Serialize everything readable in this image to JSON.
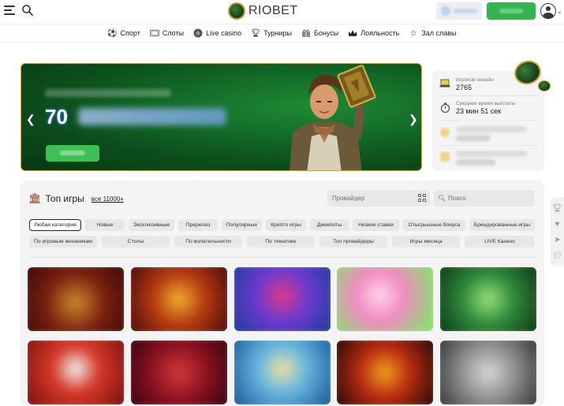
{
  "header": {
    "logo_text": "RIOBET",
    "menu_icon": "hamburger-icon",
    "search_icon": "search-icon",
    "profile_icon": "user-avatar-icon"
  },
  "nav": [
    {
      "label": "Спорт",
      "icon": "soccer-ball-icon"
    },
    {
      "label": "Слоты",
      "icon": "slot-machine-icon"
    },
    {
      "label": "Live casino",
      "icon": "live-casino-icon"
    },
    {
      "label": "Турниры",
      "icon": "trophy-icon"
    },
    {
      "label": "Бонусы",
      "icon": "gift-icon"
    },
    {
      "label": "Лояльность",
      "icon": "crown-icon"
    },
    {
      "label": "Зал славы",
      "icon": "star-icon"
    }
  ],
  "banner": {
    "amount": "70",
    "prev_icon": "chevron-left-icon",
    "next_icon": "chevron-right-icon"
  },
  "stats": {
    "players_online_label": "Игроков онлайн",
    "players_online_value": "2765",
    "avg_payout_label": "Среднее время выплаты",
    "avg_payout_value": "23 мин 51 сек"
  },
  "games": {
    "title": "Топ игры",
    "all_link": "все 11000+",
    "provider_placeholder": "Провайдер",
    "search_placeholder": "Поиск",
    "categories_row1": [
      "Любая категория",
      "Новые",
      "Эксклюзивные",
      "Пререлиз",
      "Популярные",
      "Крипто игры",
      "Джекпоты",
      "Низкие ставки",
      "Отыгрышные бонуса",
      "Брендированные игры"
    ],
    "categories_row2": [
      "По игровым механикам",
      "Столы",
      "По волатильности",
      "По тематике",
      "Топ провайдеры",
      "Игры месяца",
      "LIVE Казино"
    ],
    "active_category": "Любая категория"
  },
  "colors": {
    "accent_green": "#36b24f",
    "banner_green": "#136a28",
    "gold": "#c6a54b"
  }
}
